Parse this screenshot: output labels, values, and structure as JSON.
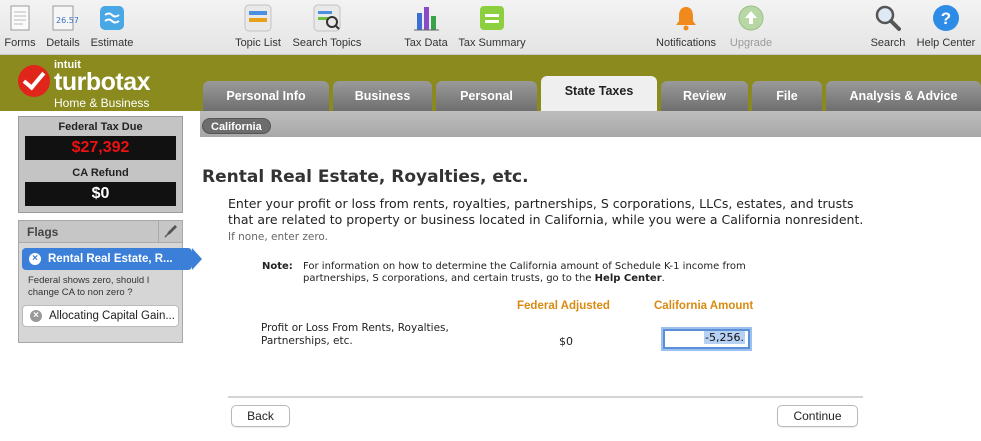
{
  "toolbar": {
    "items": [
      {
        "label": "Forms",
        "icon": "forms-icon"
      },
      {
        "label": "Details",
        "icon": "details-icon"
      },
      {
        "label": "Estimate",
        "icon": "estimate-icon"
      },
      {
        "label": "Topic List",
        "icon": "topic-list-icon"
      },
      {
        "label": "Search Topics",
        "icon": "search-topics-icon"
      },
      {
        "label": "Tax Data",
        "icon": "tax-data-icon"
      },
      {
        "label": "Tax Summary",
        "icon": "tax-summary-icon"
      },
      {
        "label": "Notifications",
        "icon": "bell-icon"
      },
      {
        "label": "Upgrade",
        "icon": "upgrade-icon"
      },
      {
        "label": "Search",
        "icon": "magnifier-icon"
      },
      {
        "label": "Help Center",
        "icon": "help-icon"
      }
    ]
  },
  "brand": {
    "company": "intuit",
    "product": "turbotax",
    "edition": "Home & Business"
  },
  "tabs": [
    {
      "label": "Personal Info"
    },
    {
      "label": "Business"
    },
    {
      "label": "Personal"
    },
    {
      "label": "State Taxes",
      "active": true
    },
    {
      "label": "Review"
    },
    {
      "label": "File"
    },
    {
      "label": "Analysis & Advice"
    }
  ],
  "subbar": {
    "state": "California"
  },
  "summary": {
    "federal_label": "Federal Tax Due",
    "federal_value": "$27,392",
    "state_label": "CA Refund",
    "state_value": "$0"
  },
  "flags": {
    "title": "Flags",
    "items": [
      {
        "label": "Rental Real Estate, R...",
        "note": "Federal shows zero, should I change CA to non zero ?"
      },
      {
        "label": "Allocating Capital Gain..."
      }
    ]
  },
  "main": {
    "title": "Rental Real Estate, Royalties, etc.",
    "intro": "Enter your profit or loss from rents, royalties, partnerships, S corporations, LLCs, estates, and trusts that are related to property or business located in California, while you were a California nonresident.",
    "intro_hint": "If none, enter zero.",
    "note_label": "Note:",
    "note_text": "For information on how to determine the California amount of Schedule K-1 income from partnerships, S corporations, and certain trusts, go to the",
    "note_link": "Help Center",
    "note_end": ".",
    "col_federal": "Federal Adjusted",
    "col_california": "California Amount",
    "row_label": "Profit or Loss From Rents, Royalties, Partnerships, etc.",
    "federal_value": "$0",
    "california_value": "-5,256."
  },
  "buttons": {
    "back": "Back",
    "continue": "Continue"
  },
  "colors": {
    "brand_bar": "#8a8a1f",
    "accent_orange": "#d98a12",
    "flag_blue": "#3b7fd9",
    "tax_due_red": "#e11111"
  }
}
